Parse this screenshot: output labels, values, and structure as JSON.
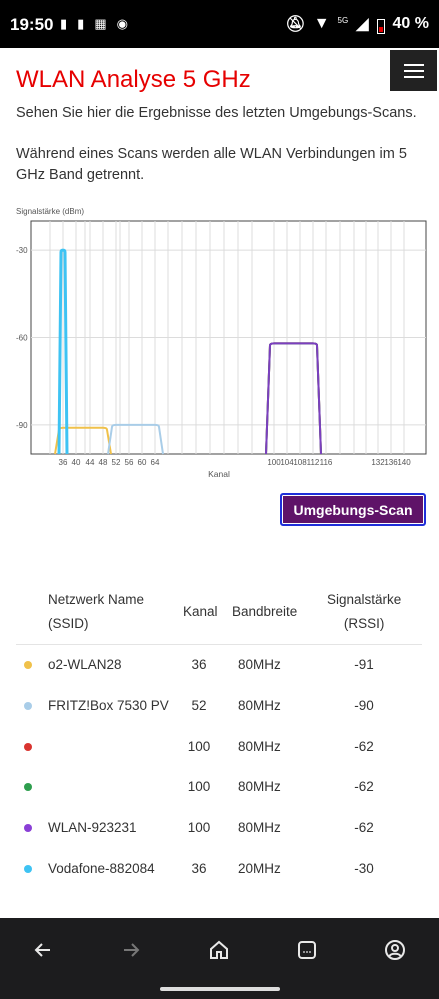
{
  "status_bar": {
    "time": "19:50",
    "network": "5G",
    "battery": "40 %"
  },
  "page": {
    "title": "WLAN Analyse 5 GHz",
    "intro1": "Sehen Sie hier die Ergebnisse des letzten Umgebungs-Scans.",
    "intro2": "Während eines Scans werden alle WLAN Verbindungen im 5 GHz Band getrennt."
  },
  "chart_data": {
    "type": "area",
    "ylabel": "Signalstärke (dBm)",
    "xlabel": "Kanal",
    "yticks": [
      -30,
      -60,
      -90
    ],
    "ylim": [
      -100,
      -20
    ],
    "xticks": [
      36,
      40,
      44,
      48,
      52,
      56,
      60,
      64,
      100,
      104,
      108,
      112,
      116,
      132,
      136,
      140
    ],
    "tick_labels": [
      "36",
      "40",
      "44",
      "48",
      "52",
      "56",
      "60",
      "64",
      "100",
      "104",
      "108",
      "112",
      "116",
      "132",
      "136",
      "140"
    ],
    "grid": true,
    "series": [
      {
        "color": "#f0c14a",
        "channel_from": 36,
        "channel_to": 48,
        "rssi": -91
      },
      {
        "color": "#a9cde8",
        "channel_from": 52,
        "channel_to": 64,
        "rssi": -90
      },
      {
        "color": "#d9342f",
        "channel_from": 100,
        "channel_to": 112,
        "rssi": -62
      },
      {
        "color": "#2e9e4e",
        "channel_from": 100,
        "channel_to": 112,
        "rssi": -62
      },
      {
        "color": "#7b3fc0",
        "channel_from": 100,
        "channel_to": 112,
        "rssi": -62
      },
      {
        "color": "#3ec3f3",
        "channel_from": 36,
        "channel_to": 36,
        "rssi": -30
      }
    ]
  },
  "scan_button": "Umgebungs-Scan",
  "table": {
    "headers": {
      "ssid_line1": "Netzwerk Name",
      "ssid_line2": "(SSID)",
      "kanal": "Kanal",
      "bandwidth": "Bandbreite",
      "rssi_line1": "Signalstärke",
      "rssi_line2": "(RSSI)"
    },
    "rows": [
      {
        "color": "#f0c14a",
        "ssid": "o2-WLAN28",
        "kanal": "36",
        "bw": "80MHz",
        "rssi": "-91"
      },
      {
        "color": "#a9cde8",
        "ssid": "FRITZ!Box 7530 PV",
        "kanal": "52",
        "bw": "80MHz",
        "rssi": "-90"
      },
      {
        "color": "#d9342f",
        "ssid": "",
        "kanal": "100",
        "bw": "80MHz",
        "rssi": "-62"
      },
      {
        "color": "#2e9e4e",
        "ssid": "",
        "kanal": "100",
        "bw": "80MHz",
        "rssi": "-62"
      },
      {
        "color": "#8a3fd6",
        "ssid": "WLAN-923231",
        "kanal": "100",
        "bw": "80MHz",
        "rssi": "-62"
      },
      {
        "color": "#3ec3f3",
        "ssid": "Vodafone-882084",
        "kanal": "36",
        "bw": "20MHz",
        "rssi": "-30"
      }
    ]
  },
  "nav": {
    "icons": [
      "back-icon",
      "forward-icon",
      "home-icon",
      "tabs-icon",
      "profile-icon"
    ]
  }
}
